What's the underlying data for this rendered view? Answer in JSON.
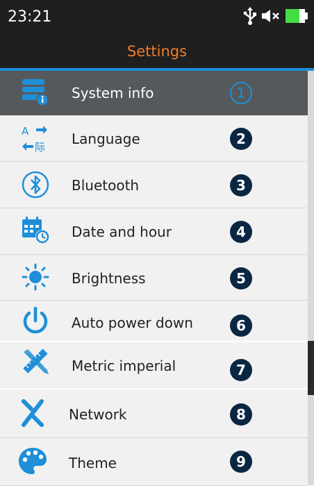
{
  "status": {
    "time": "23:21",
    "icons": [
      "usb-icon",
      "mute-icon",
      "battery-icon"
    ],
    "battery_color": "#44dd44"
  },
  "header": {
    "title": "Settings",
    "title_color": "#f07c2c",
    "accent": "#1e8fd8"
  },
  "menu": {
    "items": [
      {
        "label": "System info",
        "number": "1",
        "icon": "system-info-icon",
        "selected": true
      },
      {
        "label": "Language",
        "number": "2",
        "icon": "language-icon"
      },
      {
        "label": "Bluetooth",
        "number": "3",
        "icon": "bluetooth-icon"
      },
      {
        "label": "Date and hour",
        "number": "4",
        "icon": "calendar-clock-icon"
      },
      {
        "label": "Brightness",
        "number": "5",
        "icon": "brightness-icon"
      },
      {
        "label": "Auto power down",
        "number": "6",
        "icon": "power-icon"
      },
      {
        "label": "Metric imperial",
        "number": "7",
        "icon": "ruler-icon"
      },
      {
        "label": "Network",
        "number": "8",
        "icon": "network-icon"
      },
      {
        "label": "Theme",
        "number": "9",
        "icon": "theme-palette-icon"
      }
    ]
  }
}
